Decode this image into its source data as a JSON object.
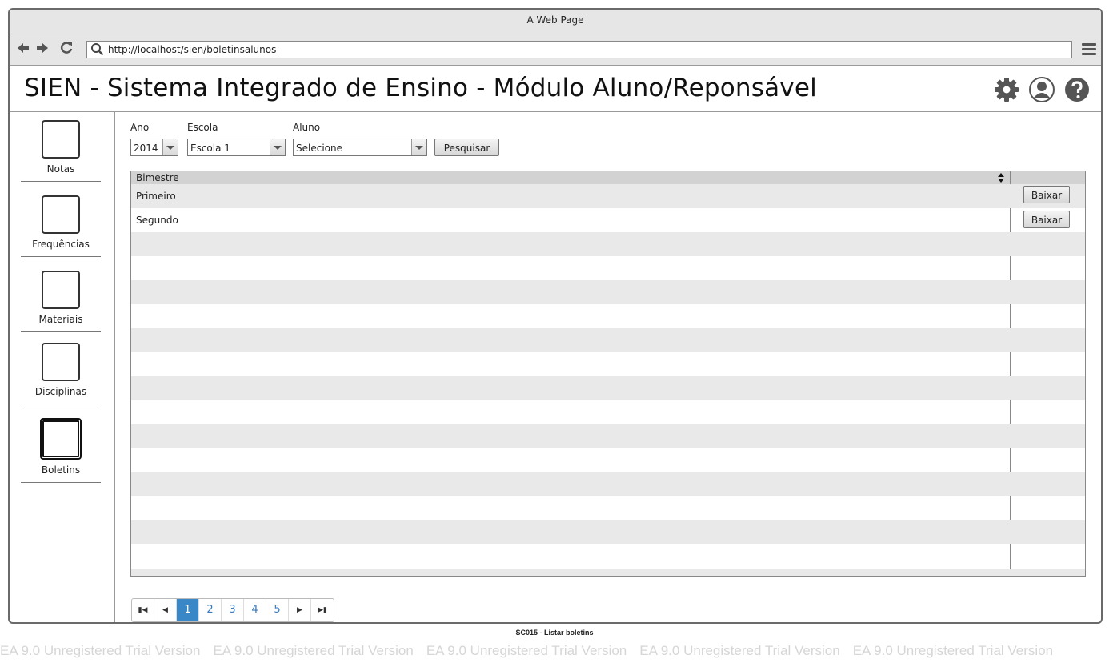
{
  "window": {
    "title": "A Web Page"
  },
  "browser": {
    "url": "http://localhost/sien/boletinsalunos"
  },
  "app": {
    "title": "SIEN - Sistema Integrado de Ensino - Módulo Aluno/Reponsável"
  },
  "header_icons": [
    "gear-icon",
    "user-icon",
    "help-icon"
  ],
  "sidebar": {
    "items": [
      {
        "label": "Notas",
        "active": false
      },
      {
        "label": "Frequências",
        "active": false
      },
      {
        "label": "Materiais",
        "active": false
      },
      {
        "label": "Disciplinas",
        "active": false
      },
      {
        "label": "Boletins",
        "active": true
      }
    ]
  },
  "filters": {
    "ano": {
      "label": "Ano",
      "value": "2014"
    },
    "escola": {
      "label": "Escola",
      "value": "Escola 1"
    },
    "aluno": {
      "label": "Aluno",
      "value": "Selecione"
    },
    "search_label": "Pesquisar"
  },
  "table": {
    "columns": [
      "Bimestre",
      ""
    ],
    "rows": [
      {
        "bimestre": "Primeiro",
        "action": "Baixar"
      },
      {
        "bimestre": "Segundo",
        "action": "Baixar"
      }
    ]
  },
  "pagination": {
    "pages": [
      "1",
      "2",
      "3",
      "4",
      "5"
    ],
    "current": "1"
  },
  "caption": "SC015 - Listar boletins",
  "watermark": "EA 9.0 Unregistered Trial Version",
  "colors": {
    "pager_active": "#3a87c8",
    "row_alt": "#e9e9e9"
  }
}
